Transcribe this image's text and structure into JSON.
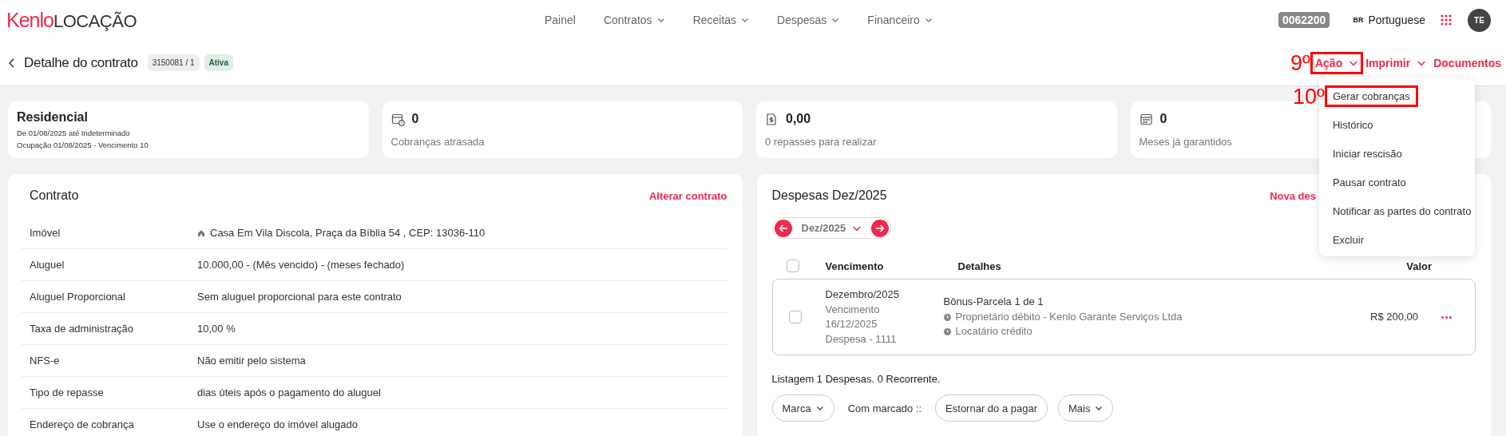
{
  "brand": {
    "logo": "Kenlo",
    "product": "LOCAÇÃO"
  },
  "nav": [
    {
      "label": "Painel",
      "dropdown": false
    },
    {
      "label": "Contratos",
      "dropdown": true
    },
    {
      "label": "Receitas",
      "dropdown": true
    },
    {
      "label": "Despesas",
      "dropdown": true
    },
    {
      "label": "Financeiro",
      "dropdown": true
    }
  ],
  "account": {
    "code": "0062200",
    "language_flag": "BR",
    "language": "Portuguese",
    "avatar": "TE"
  },
  "header": {
    "title": "Detalhe do contrato",
    "contract_number": "3150081 / 1",
    "status": "Ativa",
    "actions": [
      {
        "kind": "dropdown",
        "label": "Ação",
        "expanded": true,
        "annotation": "9º"
      },
      {
        "kind": "dropdown",
        "label": "Imprimir",
        "expanded": false
      },
      {
        "kind": "link",
        "label": "Documentos"
      }
    ]
  },
  "action_menu": [
    {
      "label": "Gerar cobranças",
      "annotation": "10º"
    },
    {
      "label": "Histórico"
    },
    {
      "label": "Iniciar rescisão"
    },
    {
      "label": "Pausar contrato"
    },
    {
      "label": "Notificar as partes do contrato"
    },
    {
      "label": "Excluir"
    }
  ],
  "summary": [
    {
      "kind": "info",
      "title": "Residencial",
      "lines": [
        "De 01/08/2025 até Indeterminado",
        "Ocupação 01/08/2025 - Vencimento 10"
      ]
    },
    {
      "kind": "overdue",
      "value": "0",
      "label": "Cobranças atrasada"
    },
    {
      "kind": "transfers",
      "value": "0,00",
      "label": "0 repasses para realizar"
    },
    {
      "kind": "months",
      "value": "0",
      "label": "Meses já garantidos"
    }
  ],
  "contract": {
    "title": "Contrato",
    "action": "Alterar contrato",
    "fields": [
      {
        "kind": "property",
        "label": "Imóvel",
        "value": "Casa Em Vila Discola, Praça da Bíblia 54 , CEP: 13036-110"
      },
      {
        "kind": "text",
        "label": "Aluguel",
        "value": "10.000,00 - (Mês vencido) - (meses fechado)"
      },
      {
        "kind": "text",
        "label": "Aluguel Proporcional",
        "value": "Sem aluguel proporcional para este contrato"
      },
      {
        "kind": "text",
        "label": "Taxa de administração",
        "value": "10,00 %"
      },
      {
        "kind": "text",
        "label": "NFS-e",
        "value": "Não emitir pelo sistema"
      },
      {
        "kind": "text",
        "label": "Tipo de repasse",
        "value": "dias úteis após o pagamento do aluguel"
      },
      {
        "kind": "text",
        "label": "Endereço de cobrança",
        "value": "Use o endereço do imóvel alugado"
      }
    ]
  },
  "expenses": {
    "title": "Despesas Dez/2025",
    "action": "Nova des",
    "period": "Dez/2025",
    "all_checked": false,
    "columns": [
      "Vencimento",
      "Detalhes",
      "Valor"
    ],
    "rows": [
      {
        "checked": false,
        "month": "Dezembro/2025",
        "due_label": "Vencimento",
        "due_date": "16/12/2025",
        "reference": "Despesa - 1111",
        "title": "Bônus-Parcela 1 de 1",
        "details": [
          "Proprietário débito - Kenlo Garante Serviços Ltda",
          "Locatário crédito"
        ],
        "amount": "R$ 200,00"
      }
    ],
    "listing": "Listagem 1 Despesas. 0 Recorrente.",
    "controls": [
      {
        "kind": "dropdown",
        "label": "Marca"
      },
      {
        "kind": "text",
        "label": "Com marcado ::"
      },
      {
        "kind": "button",
        "label": "Estornar do a pagar"
      },
      {
        "kind": "dropdown",
        "label": "Mais"
      }
    ]
  }
}
